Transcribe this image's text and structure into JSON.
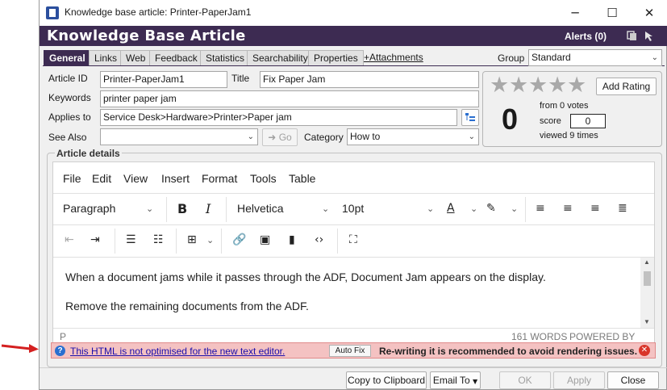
{
  "window": {
    "title": "Knowledge base article: Printer-PaperJam1",
    "controls": {
      "minimize": "─",
      "maximize": "☐",
      "close": "✕"
    }
  },
  "header": {
    "title": "Knowledge Base Article",
    "alerts": "Alerts (0)"
  },
  "tabs": [
    "General",
    "Links",
    "Web",
    "Feedback",
    "Statistics",
    "Searchability",
    "Properties",
    "+Attachments"
  ],
  "group": {
    "label": "Group",
    "value": "Standard"
  },
  "form": {
    "article_id_label": "Article ID",
    "article_id": "Printer-PaperJam1",
    "title_label": "Title",
    "title": "Fix Paper Jam",
    "keywords_label": "Keywords",
    "keywords": "printer paper jam",
    "applies_to_label": "Applies to",
    "applies_to": "Service Desk>Hardware>Printer>Paper jam",
    "see_also_label": "See Also",
    "see_also": "",
    "go_label": "Go",
    "category_label": "Category",
    "category": "How to"
  },
  "rating": {
    "stars": 5,
    "filled_stars": 0,
    "add_rating_label": "Add Rating",
    "score_big": "0",
    "votes_text": "from 0 votes",
    "score_label": "score",
    "score_value": "0",
    "viewed_text": "viewed 9 times"
  },
  "article_details": {
    "group_label": "Article details",
    "menu": [
      "File",
      "Edit",
      "View",
      "Insert",
      "Format",
      "Tools",
      "Table"
    ],
    "block_format": "Paragraph",
    "font_family": "Helvetica",
    "font_size": "10pt",
    "content": [
      "When a document jams while it passes through the ADF, Document Jam appears on the display.",
      "Remove the remaining documents from the ADF."
    ],
    "status_path": "P",
    "word_count": "161 WORDS",
    "powered_by": "POWERED BY TINY"
  },
  "warning": {
    "link_text": "This HTML is not optimised for the new text editor.",
    "autofix_label": "Auto Fix",
    "message": "Re-writing it is recommended to avoid rendering issues."
  },
  "footer": {
    "copy_label": "Copy to Clipboard",
    "email_label": "Email To",
    "ok_label": "OK",
    "apply_label": "Apply",
    "close_label": "Close"
  },
  "colors": {
    "brand": "#3d2b52",
    "warning_bg": "#f4c2c2",
    "warning_close": "#d9352a",
    "annotation_arrow": "#d42020"
  }
}
